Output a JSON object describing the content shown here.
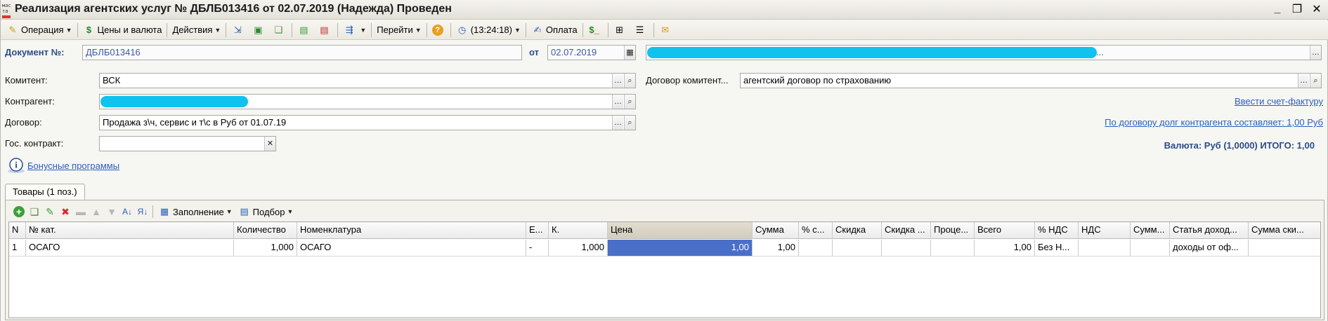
{
  "window": {
    "app_icon_text": "мас\nта",
    "title": "Реализация агентских услуг № ДБЛБ013416 от 02.07.2019 (Надежда) Проведен"
  },
  "toolbar": {
    "operation": "Операция",
    "prices_currency": "Цены и валюта",
    "actions": "Действия",
    "go": "Перейти",
    "time": "(13:24:18)",
    "payment": "Оплата"
  },
  "header": {
    "doc_no_label": "Документ №:",
    "doc_no": "ДБЛБ013416",
    "from_label": "от",
    "date": "02.07.2019",
    "org_tail": "...",
    "committent_label": "Комитент:",
    "committent": "ВСК",
    "counterparty_label": "Контрагент:",
    "contract_label": "Договор:",
    "contract": "Продажа з\\ч, сервис и т\\с в Руб от 01.07.19",
    "gov_contract_label": "Гос. контракт:",
    "committent_contract_label": "Договор комитент...",
    "committent_contract": "агентский договор по страхованию",
    "invoice_link": "Ввести счет-фактуру",
    "debt_link": "По договору долг контрагента составляет: 1,00 Руб",
    "totals": "Валюта: Руб (1,0000) ИТОГО: 1,00",
    "bonus_link": "Бонусные программы"
  },
  "tabs": [
    {
      "label": "Товары (1 поз.)"
    }
  ],
  "items_toolbar": {
    "fill": "Заполнение",
    "selection": "Подбор"
  },
  "table": {
    "columns": [
      "N",
      "№ кат.",
      "Количество",
      "Номенклатура",
      "Е...",
      "К.",
      "Цена",
      "Сумма",
      "% с...",
      "Скидка",
      "Скидка ...",
      "Проце...",
      "Всего",
      "% НДС",
      "НДС",
      "Сумм...",
      "Статья доход...",
      "Сумма ски..."
    ],
    "rows": [
      [
        "1",
        "ОСАГО",
        "1,000",
        "ОСАГО",
        "-",
        "1,000",
        "1,00",
        "1,00",
        "",
        "",
        "",
        "",
        "1,00",
        "Без Н...",
        "",
        "",
        "доходы от оф...",
        ""
      ]
    ]
  },
  "colors": {
    "redaction": "#10c2ee",
    "selected_cell": "#4a6fc9",
    "label_blue": "#2a4c8c",
    "link": "#2b5fbf"
  }
}
